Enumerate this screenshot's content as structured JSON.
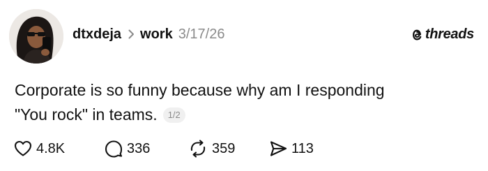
{
  "post": {
    "author": {
      "username": "dtxdeja",
      "avatar_icon": "profile-photo"
    },
    "community": "work",
    "date": "3/17/26",
    "brand": {
      "name": "threads",
      "icon": "threads-logo-icon"
    },
    "text_line1": "Corporate is so funny because why am I responding",
    "text_line2": "\"You rock\" in teams.",
    "pager": "1/2",
    "actions": {
      "likes": "4.8K",
      "replies": "336",
      "reposts": "359",
      "shares": "113"
    }
  },
  "colors": {
    "text": "#111111",
    "muted": "#8a8a8a",
    "pager_bg": "#f0f0f0"
  }
}
